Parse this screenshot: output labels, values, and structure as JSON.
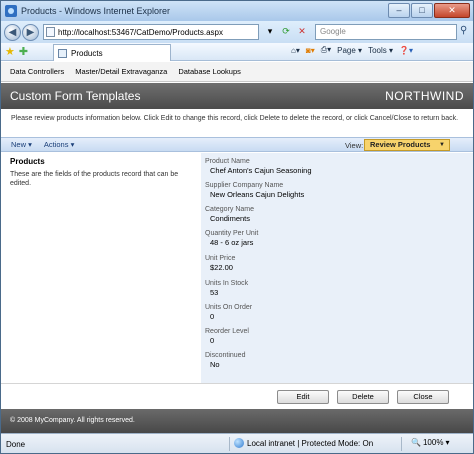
{
  "window": {
    "title": "Products - Windows Internet Explorer"
  },
  "browser": {
    "address": "http://localhost:53467/CatDemo/Products.aspx",
    "search_placeholder": "Google",
    "tab_title": "Products",
    "commands": {
      "page": "Page",
      "tools": "Tools"
    }
  },
  "menu": {
    "items": [
      "Data Controllers",
      "Master/Detail Extravaganza",
      "Database Lookups"
    ]
  },
  "banner": {
    "title": "Custom Form Templates",
    "brand": "NORTHWIND"
  },
  "description": "Please review products information below. Click Edit to change this record, click Delete to delete the record, or click Cancel/Close to return back.",
  "toolbar": {
    "new_label": "New",
    "actions_label": "Actions",
    "view_label": "View:",
    "view_value": "Review Products"
  },
  "left_panel": {
    "title": "Products",
    "text": "These are the fields of the products record that can be edited."
  },
  "fields": [
    {
      "label": "Product Name",
      "value": "Chef Anton's Cajun Seasoning"
    },
    {
      "label": "Supplier Company Name",
      "value": "New Orleans Cajun Delights"
    },
    {
      "label": "Category Name",
      "value": "Condiments"
    },
    {
      "label": "Quantity Per Unit",
      "value": "48 - 6 oz jars"
    },
    {
      "label": "Unit Price",
      "value": "$22.00"
    },
    {
      "label": "Units In Stock",
      "value": "53"
    },
    {
      "label": "Units On Order",
      "value": "0"
    },
    {
      "label": "Reorder Level",
      "value": "0"
    },
    {
      "label": "Discontinued",
      "value": "No"
    }
  ],
  "buttons": {
    "edit": "Edit",
    "delete": "Delete",
    "close": "Close"
  },
  "footer": "© 2008 MyCompany. All rights reserved.",
  "status": {
    "left": "Done",
    "zone": "Local intranet | Protected Mode: On",
    "zoom": "100%"
  }
}
